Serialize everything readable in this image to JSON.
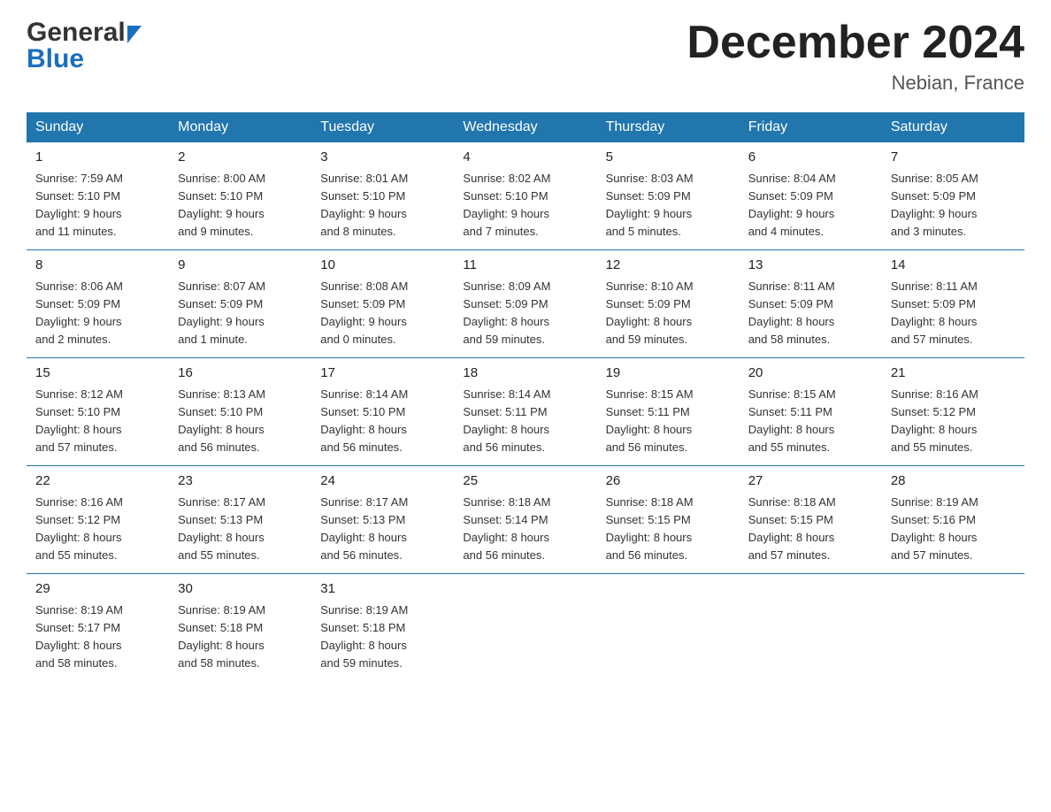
{
  "logo": {
    "line1": "General",
    "line2": "Blue"
  },
  "header": {
    "title": "December 2024",
    "subtitle": "Nebian, France"
  },
  "days_of_week": [
    "Sunday",
    "Monday",
    "Tuesday",
    "Wednesday",
    "Thursday",
    "Friday",
    "Saturday"
  ],
  "weeks": [
    [
      {
        "day": "1",
        "sunrise": "7:59 AM",
        "sunset": "5:10 PM",
        "daylight": "9 hours and 11 minutes."
      },
      {
        "day": "2",
        "sunrise": "8:00 AM",
        "sunset": "5:10 PM",
        "daylight": "9 hours and 9 minutes."
      },
      {
        "day": "3",
        "sunrise": "8:01 AM",
        "sunset": "5:10 PM",
        "daylight": "9 hours and 8 minutes."
      },
      {
        "day": "4",
        "sunrise": "8:02 AM",
        "sunset": "5:10 PM",
        "daylight": "9 hours and 7 minutes."
      },
      {
        "day": "5",
        "sunrise": "8:03 AM",
        "sunset": "5:09 PM",
        "daylight": "9 hours and 5 minutes."
      },
      {
        "day": "6",
        "sunrise": "8:04 AM",
        "sunset": "5:09 PM",
        "daylight": "9 hours and 4 minutes."
      },
      {
        "day": "7",
        "sunrise": "8:05 AM",
        "sunset": "5:09 PM",
        "daylight": "9 hours and 3 minutes."
      }
    ],
    [
      {
        "day": "8",
        "sunrise": "8:06 AM",
        "sunset": "5:09 PM",
        "daylight": "9 hours and 2 minutes."
      },
      {
        "day": "9",
        "sunrise": "8:07 AM",
        "sunset": "5:09 PM",
        "daylight": "9 hours and 1 minute."
      },
      {
        "day": "10",
        "sunrise": "8:08 AM",
        "sunset": "5:09 PM",
        "daylight": "9 hours and 0 minutes."
      },
      {
        "day": "11",
        "sunrise": "8:09 AM",
        "sunset": "5:09 PM",
        "daylight": "8 hours and 59 minutes."
      },
      {
        "day": "12",
        "sunrise": "8:10 AM",
        "sunset": "5:09 PM",
        "daylight": "8 hours and 59 minutes."
      },
      {
        "day": "13",
        "sunrise": "8:11 AM",
        "sunset": "5:09 PM",
        "daylight": "8 hours and 58 minutes."
      },
      {
        "day": "14",
        "sunrise": "8:11 AM",
        "sunset": "5:09 PM",
        "daylight": "8 hours and 57 minutes."
      }
    ],
    [
      {
        "day": "15",
        "sunrise": "8:12 AM",
        "sunset": "5:10 PM",
        "daylight": "8 hours and 57 minutes."
      },
      {
        "day": "16",
        "sunrise": "8:13 AM",
        "sunset": "5:10 PM",
        "daylight": "8 hours and 56 minutes."
      },
      {
        "day": "17",
        "sunrise": "8:14 AM",
        "sunset": "5:10 PM",
        "daylight": "8 hours and 56 minutes."
      },
      {
        "day": "18",
        "sunrise": "8:14 AM",
        "sunset": "5:11 PM",
        "daylight": "8 hours and 56 minutes."
      },
      {
        "day": "19",
        "sunrise": "8:15 AM",
        "sunset": "5:11 PM",
        "daylight": "8 hours and 56 minutes."
      },
      {
        "day": "20",
        "sunrise": "8:15 AM",
        "sunset": "5:11 PM",
        "daylight": "8 hours and 55 minutes."
      },
      {
        "day": "21",
        "sunrise": "8:16 AM",
        "sunset": "5:12 PM",
        "daylight": "8 hours and 55 minutes."
      }
    ],
    [
      {
        "day": "22",
        "sunrise": "8:16 AM",
        "sunset": "5:12 PM",
        "daylight": "8 hours and 55 minutes."
      },
      {
        "day": "23",
        "sunrise": "8:17 AM",
        "sunset": "5:13 PM",
        "daylight": "8 hours and 55 minutes."
      },
      {
        "day": "24",
        "sunrise": "8:17 AM",
        "sunset": "5:13 PM",
        "daylight": "8 hours and 56 minutes."
      },
      {
        "day": "25",
        "sunrise": "8:18 AM",
        "sunset": "5:14 PM",
        "daylight": "8 hours and 56 minutes."
      },
      {
        "day": "26",
        "sunrise": "8:18 AM",
        "sunset": "5:15 PM",
        "daylight": "8 hours and 56 minutes."
      },
      {
        "day": "27",
        "sunrise": "8:18 AM",
        "sunset": "5:15 PM",
        "daylight": "8 hours and 57 minutes."
      },
      {
        "day": "28",
        "sunrise": "8:19 AM",
        "sunset": "5:16 PM",
        "daylight": "8 hours and 57 minutes."
      }
    ],
    [
      {
        "day": "29",
        "sunrise": "8:19 AM",
        "sunset": "5:17 PM",
        "daylight": "8 hours and 58 minutes."
      },
      {
        "day": "30",
        "sunrise": "8:19 AM",
        "sunset": "5:18 PM",
        "daylight": "8 hours and 58 minutes."
      },
      {
        "day": "31",
        "sunrise": "8:19 AM",
        "sunset": "5:18 PM",
        "daylight": "8 hours and 59 minutes."
      },
      null,
      null,
      null,
      null
    ]
  ],
  "labels": {
    "sunrise": "Sunrise:",
    "sunset": "Sunset:",
    "daylight": "Daylight:"
  }
}
